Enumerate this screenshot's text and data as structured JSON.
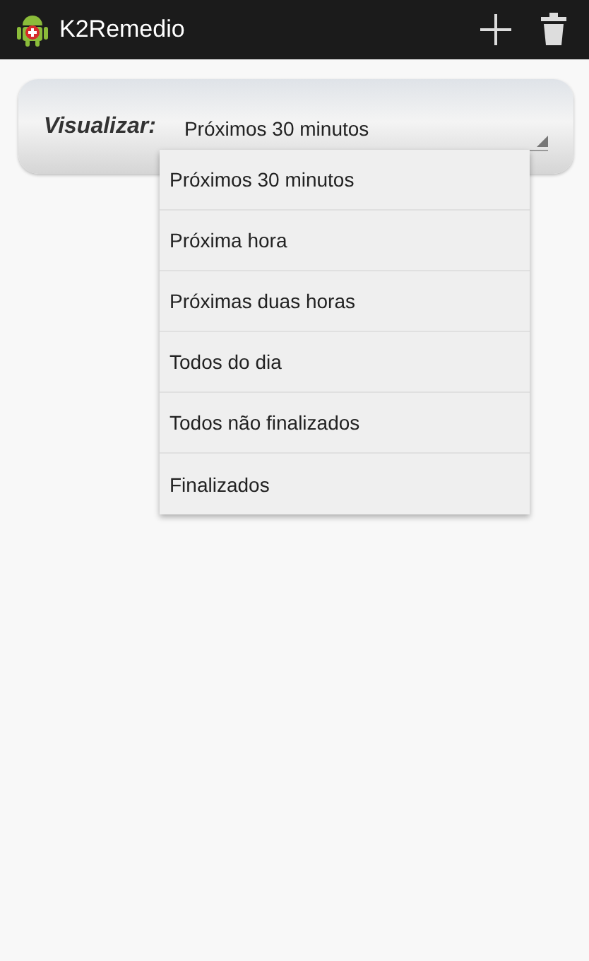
{
  "action_bar": {
    "title": "K2Remedio"
  },
  "filter": {
    "label": "Visualizar:",
    "value": "Próximos 30 minutos",
    "expanded": true
  },
  "options": [
    {
      "label": "Próximos 30 minutos"
    },
    {
      "label": "Próxima hora"
    },
    {
      "label": "Próximas duas horas"
    },
    {
      "label": "Todos do dia"
    },
    {
      "label": "Todos não finalizados"
    },
    {
      "label": "Finalizados"
    }
  ]
}
